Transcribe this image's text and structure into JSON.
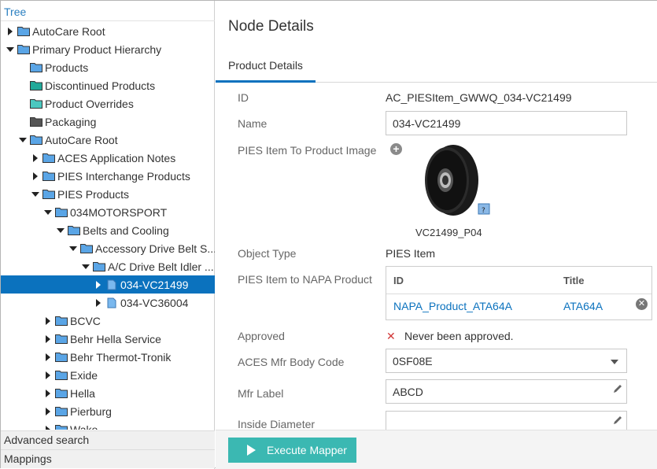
{
  "tree": {
    "header": "Tree",
    "items": [
      {
        "label": "AutoCare Root",
        "expanded": false,
        "color": "#5aa5e6",
        "level": 0
      },
      {
        "label": "Primary Product Hierarchy",
        "expanded": true,
        "color": "#5aa5e6",
        "level": 0
      },
      {
        "label": "Products",
        "expanded": null,
        "color": "#5aa5e6",
        "level": 1
      },
      {
        "label": "Discontinued Products",
        "expanded": null,
        "color": "#22a99a",
        "level": 1
      },
      {
        "label": "Product Overrides",
        "expanded": null,
        "color": "#4bc8c0",
        "level": 1
      },
      {
        "label": "Packaging",
        "expanded": null,
        "color": "#555555",
        "level": 1
      },
      {
        "label": "AutoCare Root",
        "expanded": true,
        "color": "#5aa5e6",
        "level": 1
      },
      {
        "label": "ACES Application Notes",
        "expanded": false,
        "color": "#5aa5e6",
        "level": 2
      },
      {
        "label": "PIES Interchange Products",
        "expanded": false,
        "color": "#5aa5e6",
        "level": 2
      },
      {
        "label": "PIES Products",
        "expanded": true,
        "color": "#5aa5e6",
        "level": 2
      },
      {
        "label": "034MOTORSPORT",
        "expanded": true,
        "color": "#5aa5e6",
        "level": 3
      },
      {
        "label": "Belts and Cooling",
        "expanded": true,
        "color": "#5aa5e6",
        "level": 4
      },
      {
        "label": "Accessory Drive Belt S...",
        "expanded": true,
        "color": "#5aa5e6",
        "level": 5
      },
      {
        "label": "A/C Drive Belt Idler ...",
        "expanded": true,
        "color": "#5aa5e6",
        "level": 6
      },
      {
        "label": "034-VC21499",
        "expanded": false,
        "color": "#7ab8ee",
        "level": 7,
        "selected": true,
        "doc": true
      },
      {
        "label": "034-VC36004",
        "expanded": false,
        "color": "#7ab8ee",
        "level": 7,
        "doc": true
      },
      {
        "label": "BCVC",
        "expanded": false,
        "color": "#5aa5e6",
        "level": 3
      },
      {
        "label": "Behr Hella Service",
        "expanded": false,
        "color": "#5aa5e6",
        "level": 3
      },
      {
        "label": "Behr Thermot-Tronik",
        "expanded": false,
        "color": "#5aa5e6",
        "level": 3
      },
      {
        "label": "Exide",
        "expanded": false,
        "color": "#5aa5e6",
        "level": 3
      },
      {
        "label": "Hella",
        "expanded": false,
        "color": "#5aa5e6",
        "level": 3
      },
      {
        "label": "Pierburg",
        "expanded": false,
        "color": "#5aa5e6",
        "level": 3
      },
      {
        "label": "Wako",
        "expanded": false,
        "color": "#5aa5e6",
        "level": 3
      }
    ]
  },
  "footer": {
    "advanced_search": "Advanced search",
    "mappings": "Mappings"
  },
  "details": {
    "title": "Node Details",
    "tab": "Product Details",
    "fields": {
      "id_label": "ID",
      "id_value": "AC_PIESItem_GWWQ_034-VC21499",
      "name_label": "Name",
      "name_value": "034-VC21499",
      "image_label": "PIES Item To Product Image",
      "image_caption": "VC21499_P04",
      "object_type_label": "Object Type",
      "object_type_value": "PIES Item",
      "napa_label": "PIES Item to NAPA Product",
      "approved_label": "Approved",
      "approved_value": "Never been approved.",
      "aces_label": "ACES Mfr Body Code",
      "aces_value": "0SF08E",
      "mfr_label": "Mfr Label",
      "mfr_value": "ABCD",
      "inside_diameter_label": "Inside Diameter",
      "inside_diameter_value": ""
    },
    "napa_table": {
      "col_id": "ID",
      "col_title": "Title",
      "row_id": "NAPA_Product_ATA64A",
      "row_title": "ATA64A"
    },
    "execute_button": "Execute Mapper"
  },
  "colors": {
    "accent": "#0b72be",
    "execute": "#3bb8b2",
    "error": "#d23a3a"
  }
}
